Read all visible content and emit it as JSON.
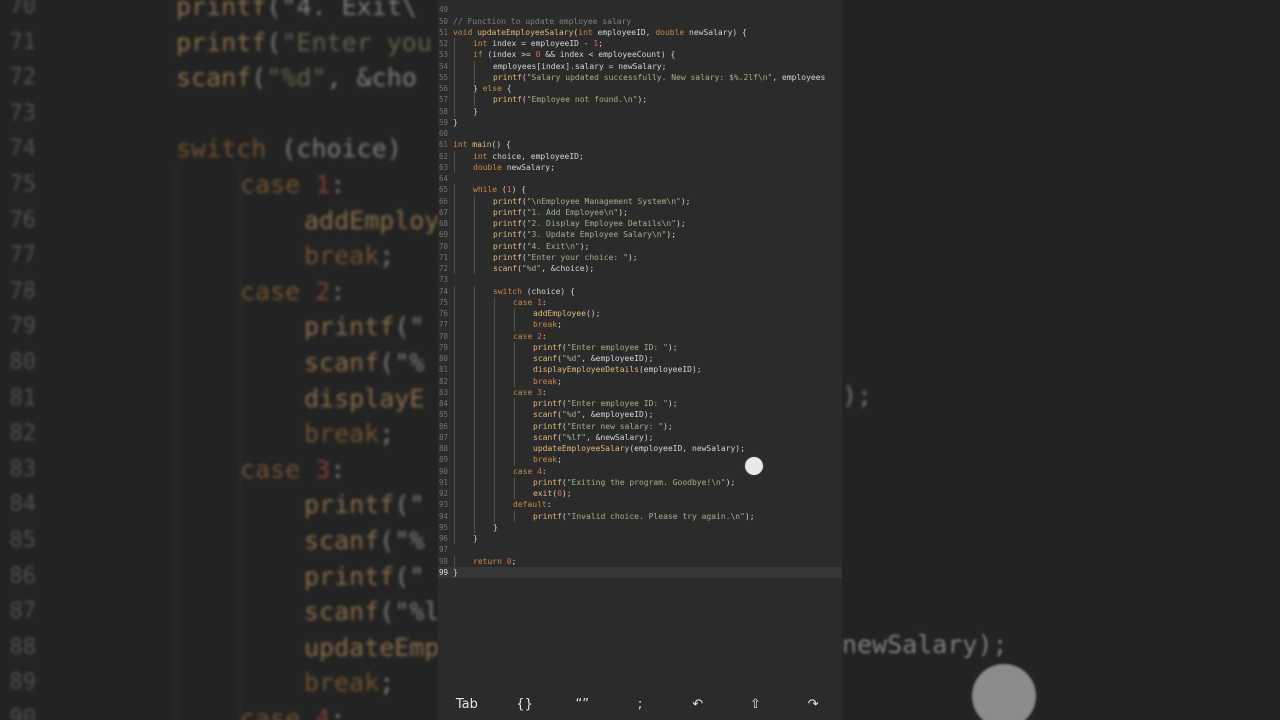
{
  "editor": {
    "current_line": 99,
    "lines": [
      {
        "n": 49,
        "i": 0,
        "t": [
          [
            "",
            ""
          ]
        ]
      },
      {
        "n": 50,
        "i": 0,
        "t": [
          [
            "cm",
            "// Function to update employee salary"
          ]
        ]
      },
      {
        "n": 51,
        "i": 0,
        "t": [
          [
            "kw",
            "void "
          ],
          [
            "fn",
            "updateEmployeeSalary"
          ],
          [
            "",
            "("
          ],
          [
            "kw",
            "int "
          ],
          [
            "",
            "employeeID, "
          ],
          [
            "kw",
            "double "
          ],
          [
            "",
            "newSalary) {"
          ]
        ]
      },
      {
        "n": 52,
        "i": 1,
        "t": [
          [
            "kw",
            "int "
          ],
          [
            "",
            "index = employeeID - "
          ],
          [
            "num",
            "1"
          ],
          [
            "",
            ";"
          ]
        ]
      },
      {
        "n": 53,
        "i": 1,
        "t": [
          [
            "kw",
            "if "
          ],
          [
            "",
            "(index >= "
          ],
          [
            "num",
            "0"
          ],
          [
            "",
            " && index < employeeCount) {"
          ]
        ]
      },
      {
        "n": 54,
        "i": 2,
        "t": [
          [
            "",
            "employees[index].salary = newSalary;"
          ]
        ]
      },
      {
        "n": 55,
        "i": 2,
        "t": [
          [
            "fn",
            "printf"
          ],
          [
            "",
            "("
          ],
          [
            "str",
            "\"Salary updated successfully. New salary: $%.2lf\\n\""
          ],
          [
            "",
            ", employees"
          ]
        ]
      },
      {
        "n": 56,
        "i": 1,
        "t": [
          [
            "",
            "} "
          ],
          [
            "kw",
            "else "
          ],
          [
            "",
            "{"
          ]
        ]
      },
      {
        "n": 57,
        "i": 2,
        "t": [
          [
            "fn",
            "printf"
          ],
          [
            "",
            "("
          ],
          [
            "str",
            "\"Employee not found.\\n\""
          ],
          [
            "",
            ");"
          ]
        ]
      },
      {
        "n": 58,
        "i": 1,
        "t": [
          [
            "",
            "}"
          ]
        ]
      },
      {
        "n": 59,
        "i": 0,
        "t": [
          [
            "",
            "}"
          ]
        ]
      },
      {
        "n": 60,
        "i": 0,
        "t": [
          [
            "",
            ""
          ]
        ]
      },
      {
        "n": 61,
        "i": 0,
        "t": [
          [
            "kw",
            "int "
          ],
          [
            "fn",
            "main"
          ],
          [
            "",
            "() {"
          ]
        ]
      },
      {
        "n": 62,
        "i": 1,
        "t": [
          [
            "kw",
            "int "
          ],
          [
            "",
            "choice, employeeID;"
          ]
        ]
      },
      {
        "n": 63,
        "i": 1,
        "t": [
          [
            "kw",
            "double "
          ],
          [
            "",
            "newSalary;"
          ]
        ]
      },
      {
        "n": 64,
        "i": 0,
        "t": [
          [
            "",
            ""
          ]
        ]
      },
      {
        "n": 65,
        "i": 1,
        "t": [
          [
            "kw",
            "while "
          ],
          [
            "",
            "("
          ],
          [
            "num",
            "1"
          ],
          [
            "",
            ") {"
          ]
        ]
      },
      {
        "n": 66,
        "i": 2,
        "t": [
          [
            "fn",
            "printf"
          ],
          [
            "",
            "("
          ],
          [
            "str",
            "\"\\nEmployee Management System\\n\""
          ],
          [
            "",
            ");"
          ]
        ]
      },
      {
        "n": 67,
        "i": 2,
        "t": [
          [
            "fn",
            "printf"
          ],
          [
            "",
            "("
          ],
          [
            "str",
            "\"1. Add Employee\\n\""
          ],
          [
            "",
            ");"
          ]
        ]
      },
      {
        "n": 68,
        "i": 2,
        "t": [
          [
            "fn",
            "printf"
          ],
          [
            "",
            "("
          ],
          [
            "str",
            "\"2. Display Employee Details\\n\""
          ],
          [
            "",
            ");"
          ]
        ]
      },
      {
        "n": 69,
        "i": 2,
        "t": [
          [
            "fn",
            "printf"
          ],
          [
            "",
            "("
          ],
          [
            "str",
            "\"3. Update Employee Salary\\n\""
          ],
          [
            "",
            ");"
          ]
        ]
      },
      {
        "n": 70,
        "i": 2,
        "t": [
          [
            "fn",
            "printf"
          ],
          [
            "",
            "("
          ],
          [
            "str",
            "\"4. Exit\\n\""
          ],
          [
            "",
            ");"
          ]
        ]
      },
      {
        "n": 71,
        "i": 2,
        "t": [
          [
            "fn",
            "printf"
          ],
          [
            "",
            "("
          ],
          [
            "str",
            "\"Enter your choice: \""
          ],
          [
            "",
            ");"
          ]
        ]
      },
      {
        "n": 72,
        "i": 2,
        "t": [
          [
            "fn",
            "scanf"
          ],
          [
            "",
            "("
          ],
          [
            "str",
            "\"%d\""
          ],
          [
            "",
            ", &choice);"
          ]
        ]
      },
      {
        "n": 73,
        "i": 0,
        "t": [
          [
            "",
            ""
          ]
        ]
      },
      {
        "n": 74,
        "i": 2,
        "t": [
          [
            "kw",
            "switch "
          ],
          [
            "",
            "(choice) {"
          ]
        ]
      },
      {
        "n": 75,
        "i": 3,
        "t": [
          [
            "kw",
            "case "
          ],
          [
            "num",
            "1"
          ],
          [
            "",
            ":"
          ]
        ]
      },
      {
        "n": 76,
        "i": 4,
        "t": [
          [
            "fn",
            "addEmployee"
          ],
          [
            "",
            "();"
          ]
        ]
      },
      {
        "n": 77,
        "i": 4,
        "t": [
          [
            "kw",
            "break"
          ],
          [
            "",
            ";"
          ]
        ]
      },
      {
        "n": 78,
        "i": 3,
        "t": [
          [
            "kw",
            "case "
          ],
          [
            "num",
            "2"
          ],
          [
            "",
            ":"
          ]
        ]
      },
      {
        "n": 79,
        "i": 4,
        "t": [
          [
            "fn",
            "printf"
          ],
          [
            "",
            "("
          ],
          [
            "str",
            "\"Enter employee ID: \""
          ],
          [
            "",
            ");"
          ]
        ]
      },
      {
        "n": 80,
        "i": 4,
        "t": [
          [
            "fn",
            "scanf"
          ],
          [
            "",
            "("
          ],
          [
            "str",
            "\"%d\""
          ],
          [
            "",
            ", &employeeID);"
          ]
        ]
      },
      {
        "n": 81,
        "i": 4,
        "t": [
          [
            "fn",
            "displayEmployeeDetails"
          ],
          [
            "",
            "(employeeID);"
          ]
        ]
      },
      {
        "n": 82,
        "i": 4,
        "t": [
          [
            "kw",
            "break"
          ],
          [
            "",
            ";"
          ]
        ]
      },
      {
        "n": 83,
        "i": 3,
        "t": [
          [
            "kw",
            "case "
          ],
          [
            "num",
            "3"
          ],
          [
            "",
            ":"
          ]
        ]
      },
      {
        "n": 84,
        "i": 4,
        "t": [
          [
            "fn",
            "printf"
          ],
          [
            "",
            "("
          ],
          [
            "str",
            "\"Enter employee ID: \""
          ],
          [
            "",
            ");"
          ]
        ]
      },
      {
        "n": 85,
        "i": 4,
        "t": [
          [
            "fn",
            "scanf"
          ],
          [
            "",
            "("
          ],
          [
            "str",
            "\"%d\""
          ],
          [
            "",
            ", &employeeID);"
          ]
        ]
      },
      {
        "n": 86,
        "i": 4,
        "t": [
          [
            "fn",
            "printf"
          ],
          [
            "",
            "("
          ],
          [
            "str",
            "\"Enter new salary: \""
          ],
          [
            "",
            ");"
          ]
        ]
      },
      {
        "n": 87,
        "i": 4,
        "t": [
          [
            "fn",
            "scanf"
          ],
          [
            "",
            "("
          ],
          [
            "str",
            "\"%lf\""
          ],
          [
            "",
            ", &newSalary);"
          ]
        ]
      },
      {
        "n": 88,
        "i": 4,
        "t": [
          [
            "fn",
            "updateEmployeeSalary"
          ],
          [
            "",
            "(employeeID, newSalary);"
          ]
        ]
      },
      {
        "n": 89,
        "i": 4,
        "t": [
          [
            "kw",
            "break"
          ],
          [
            "",
            ";"
          ]
        ]
      },
      {
        "n": 90,
        "i": 3,
        "t": [
          [
            "kw",
            "case "
          ],
          [
            "num",
            "4"
          ],
          [
            "",
            ":"
          ]
        ]
      },
      {
        "n": 91,
        "i": 4,
        "t": [
          [
            "fn",
            "printf"
          ],
          [
            "",
            "("
          ],
          [
            "str",
            "\"Exiting the program. Goodbye!\\n\""
          ],
          [
            "",
            ");"
          ]
        ]
      },
      {
        "n": 92,
        "i": 4,
        "t": [
          [
            "fn",
            "exit"
          ],
          [
            "",
            "("
          ],
          [
            "num",
            "0"
          ],
          [
            "",
            ");"
          ]
        ]
      },
      {
        "n": 93,
        "i": 3,
        "t": [
          [
            "kw",
            "default"
          ],
          [
            "",
            ":"
          ]
        ]
      },
      {
        "n": 94,
        "i": 4,
        "t": [
          [
            "fn",
            "printf"
          ],
          [
            "",
            "("
          ],
          [
            "str",
            "\"Invalid choice. Please try again.\\n\""
          ],
          [
            "",
            ");"
          ]
        ]
      },
      {
        "n": 95,
        "i": 2,
        "t": [
          [
            "",
            "}"
          ]
        ]
      },
      {
        "n": 96,
        "i": 1,
        "t": [
          [
            "",
            "}"
          ]
        ]
      },
      {
        "n": 97,
        "i": 0,
        "t": [
          [
            "",
            ""
          ]
        ]
      },
      {
        "n": 98,
        "i": 1,
        "t": [
          [
            "kw",
            "return "
          ],
          [
            "num",
            "0"
          ],
          [
            "",
            ";"
          ]
        ]
      },
      {
        "n": 99,
        "i": 0,
        "t": [
          [
            "",
            "}"
          ]
        ]
      }
    ]
  },
  "background_zoom": {
    "first_line": 70,
    "lines": [
      {
        "n": "70",
        "i": 0,
        "t": [
          [
            "fn",
            "printf"
          ],
          [
            "",
            "(\"4. Exit\\"
          ]
        ]
      },
      {
        "n": "71",
        "i": 0,
        "t": [
          [
            "fn",
            "printf"
          ],
          [
            "",
            "("
          ],
          [
            "bg-str",
            "\"Enter you"
          ]
        ]
      },
      {
        "n": "72",
        "i": 0,
        "t": [
          [
            "fn",
            "scanf"
          ],
          [
            "",
            "("
          ],
          [
            "bg-str",
            "\"%d\""
          ],
          [
            "",
            ", &cho"
          ]
        ]
      },
      {
        "n": "73",
        "i": 0,
        "t": [
          [
            "",
            ""
          ]
        ]
      },
      {
        "n": "74",
        "i": 0,
        "t": [
          [
            "kw",
            "switch "
          ],
          [
            "",
            "(choice)"
          ]
        ]
      },
      {
        "n": "75",
        "i": 1,
        "t": [
          [
            "kw",
            "case "
          ],
          [
            "num",
            "1"
          ],
          [
            "",
            ":"
          ]
        ]
      },
      {
        "n": "76",
        "i": 2,
        "t": [
          [
            "fn",
            "addEmploye"
          ]
        ]
      },
      {
        "n": "77",
        "i": 2,
        "t": [
          [
            "kw",
            "break"
          ],
          [
            "",
            ";"
          ]
        ]
      },
      {
        "n": "78",
        "i": 1,
        "t": [
          [
            "kw",
            "case "
          ],
          [
            "num",
            "2"
          ],
          [
            "",
            ":"
          ]
        ]
      },
      {
        "n": "79",
        "i": 2,
        "t": [
          [
            "fn",
            "printf"
          ],
          [
            "",
            "(\""
          ]
        ]
      },
      {
        "n": "80",
        "i": 2,
        "t": [
          [
            "fn",
            "scanf"
          ],
          [
            "",
            "(\"%"
          ]
        ]
      },
      {
        "n": "81",
        "i": 2,
        "t": [
          [
            "fn",
            "displayE"
          ]
        ]
      },
      {
        "n": "82",
        "i": 2,
        "t": [
          [
            "kw",
            "break"
          ],
          [
            "",
            ";"
          ]
        ]
      },
      {
        "n": "83",
        "i": 1,
        "t": [
          [
            "kw",
            "case "
          ],
          [
            "num",
            "3"
          ],
          [
            "",
            ":"
          ]
        ]
      },
      {
        "n": "84",
        "i": 2,
        "t": [
          [
            "fn",
            "printf"
          ],
          [
            "",
            "(\""
          ]
        ]
      },
      {
        "n": "85",
        "i": 2,
        "t": [
          [
            "fn",
            "scanf"
          ],
          [
            "",
            "(\"%"
          ]
        ]
      },
      {
        "n": "86",
        "i": 2,
        "t": [
          [
            "fn",
            "printf"
          ],
          [
            "",
            "(\""
          ]
        ]
      },
      {
        "n": "87",
        "i": 2,
        "t": [
          [
            "fn",
            "scanf"
          ],
          [
            "",
            "(\"%l"
          ]
        ]
      },
      {
        "n": "88",
        "i": 2,
        "t": [
          [
            "fn",
            "updateEmp"
          ]
        ]
      },
      {
        "n": "89",
        "i": 2,
        "t": [
          [
            "kw",
            "break"
          ],
          [
            "",
            ";"
          ]
        ]
      },
      {
        "n": "90",
        "i": 1,
        "t": [
          [
            "kw",
            "case "
          ],
          [
            "num",
            "4"
          ],
          [
            "",
            ":"
          ]
        ]
      }
    ],
    "right_fragments": {
      "line81": ");",
      "line88": "newSalary);"
    }
  },
  "toolbar": {
    "keys": [
      {
        "id": "tab",
        "label": "Tab"
      },
      {
        "id": "braces",
        "label": "{}"
      },
      {
        "id": "quotes",
        "label": "“”"
      },
      {
        "id": "semicolon",
        "label": ";"
      },
      {
        "id": "undo",
        "label": "↶"
      },
      {
        "id": "shift",
        "label": "⇧"
      },
      {
        "id": "redo",
        "label": "↷"
      }
    ]
  }
}
